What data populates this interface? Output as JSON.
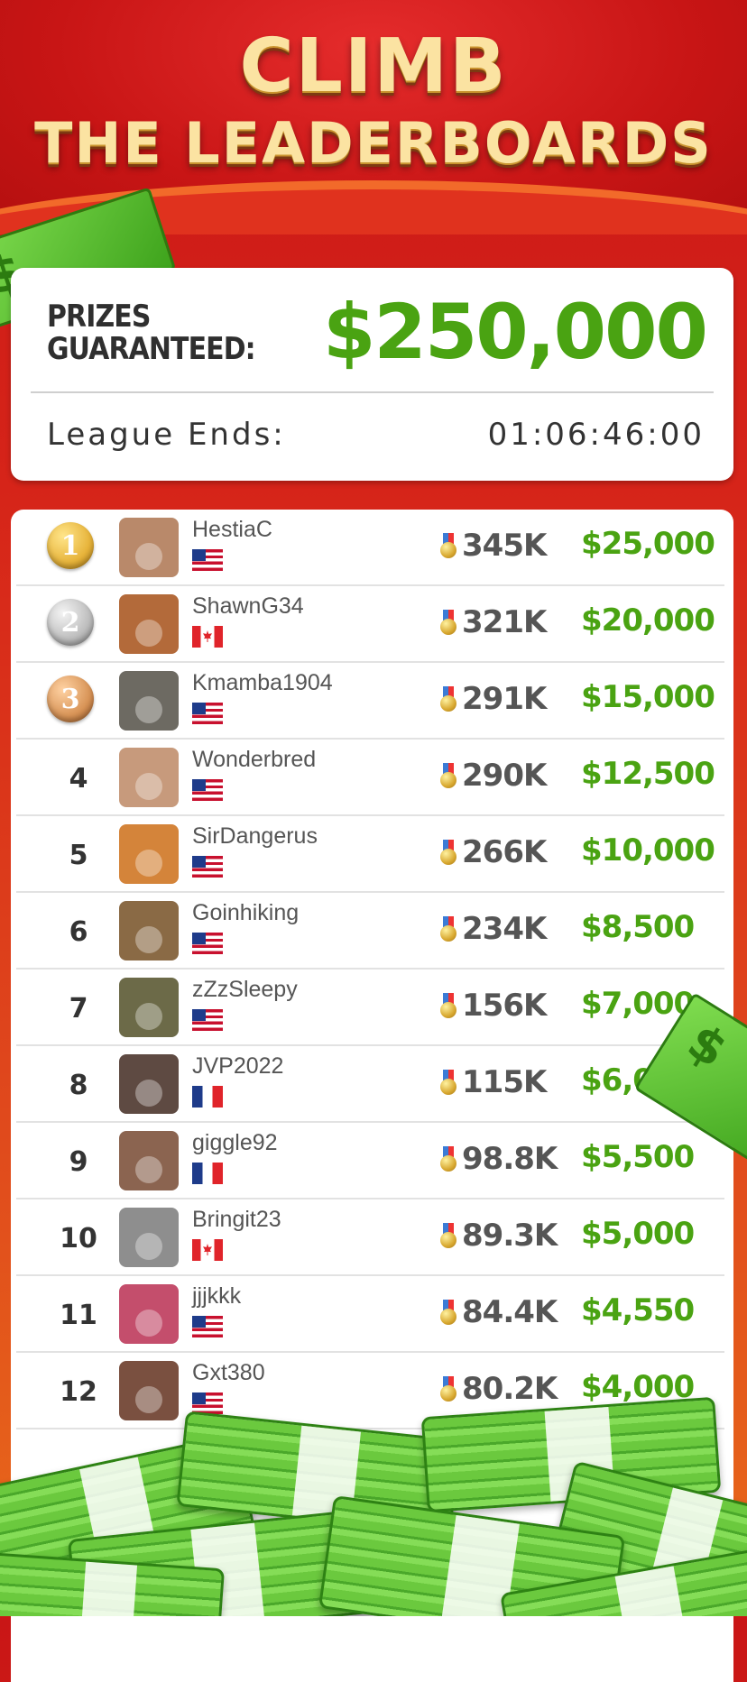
{
  "header": {
    "title_line1": "CLIMB",
    "title_line2": "THE LEADERBOARDS"
  },
  "prize_card": {
    "prizes_label_line1": "PRIZES",
    "prizes_label_line2": "GUARANTEED:",
    "prize_total": "$250,000",
    "league_label": "League Ends:",
    "league_time": "01:06:46:00"
  },
  "decor": {
    "bill_symbol": "$"
  },
  "leaderboard": {
    "rows": [
      {
        "rank": "1",
        "medal": "gold",
        "medal_text": "1",
        "name": "HestiaC",
        "flag": "us",
        "score": "345K",
        "prize": "$25,000",
        "avatar_color": "#b9896a"
      },
      {
        "rank": "2",
        "medal": "silver",
        "medal_text": "2",
        "name": "ShawnG34",
        "flag": "ca",
        "score": "321K",
        "prize": "$20,000",
        "avatar_color": "#b36a3a"
      },
      {
        "rank": "3",
        "medal": "bronze",
        "medal_text": "3",
        "name": "Kmamba1904",
        "flag": "us",
        "score": "291K",
        "prize": "$15,000",
        "avatar_color": "#6d6a62"
      },
      {
        "rank": "4",
        "medal": "",
        "medal_text": "",
        "name": "Wonderbred",
        "flag": "us",
        "score": "290K",
        "prize": "$12,500",
        "avatar_color": "#c79a7c"
      },
      {
        "rank": "5",
        "medal": "",
        "medal_text": "",
        "name": "SirDangerus",
        "flag": "us",
        "score": "266K",
        "prize": "$10,000",
        "avatar_color": "#d4843a"
      },
      {
        "rank": "6",
        "medal": "",
        "medal_text": "",
        "name": "Goinhiking",
        "flag": "us",
        "score": "234K",
        "prize": "$8,500",
        "avatar_color": "#8a6a45"
      },
      {
        "rank": "7",
        "medal": "",
        "medal_text": "",
        "name": "zZzSleepy",
        "flag": "us",
        "score": "156K",
        "prize": "$7,000",
        "avatar_color": "#6c6a48"
      },
      {
        "rank": "8",
        "medal": "",
        "medal_text": "",
        "name": "JVP2022",
        "flag": "fr",
        "score": "115K",
        "prize": "$6,000",
        "avatar_color": "#5e4a42"
      },
      {
        "rank": "9",
        "medal": "",
        "medal_text": "",
        "name": "giggle92",
        "flag": "fr",
        "score": "98.8K",
        "prize": "$5,500",
        "avatar_color": "#8b6450"
      },
      {
        "rank": "10",
        "medal": "",
        "medal_text": "",
        "name": "Bringit23",
        "flag": "ca",
        "score": "89.3K",
        "prize": "$5,000",
        "avatar_color": "#8e8e8e"
      },
      {
        "rank": "11",
        "medal": "",
        "medal_text": "",
        "name": "jjjkkk",
        "flag": "us",
        "score": "84.4K",
        "prize": "$4,550",
        "avatar_color": "#c44e6c"
      },
      {
        "rank": "12",
        "medal": "",
        "medal_text": "",
        "name": "Gxt380",
        "flag": "us",
        "score": "80.2K",
        "prize": "$4,000",
        "avatar_color": "#7a5040"
      }
    ]
  },
  "colors": {
    "accent_green": "#4aa312",
    "header_red": "#c91616",
    "title_gold": "#fbe3a2"
  }
}
